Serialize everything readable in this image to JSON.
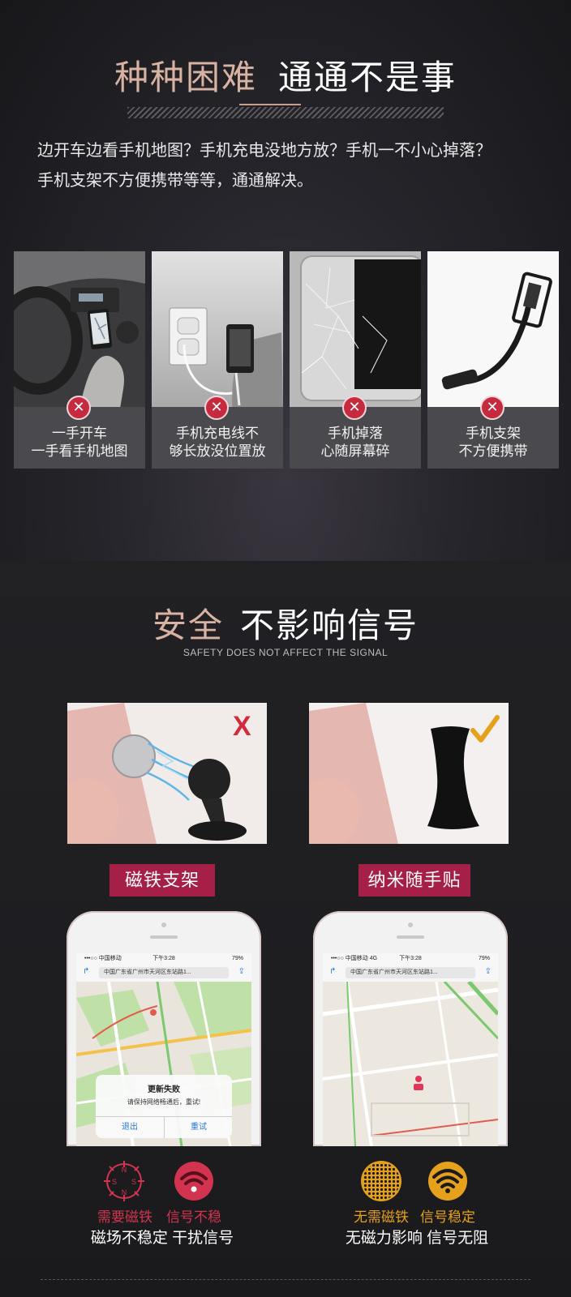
{
  "section1": {
    "title_part1": "种种困难",
    "title_part2": "通通不是事",
    "intro_line1": "边开车边看手机地图？手机充电没地方放？手机一不小心掉落？",
    "intro_line2": "手机支架不方便携带等等，通通解决。",
    "cards": [
      {
        "line1": "一手开车",
        "line2": "一手看手机地图"
      },
      {
        "line1": "手机充电线不",
        "line2": "够长放没位置放"
      },
      {
        "line1": "手机掉落",
        "line2": "心随屏幕碎"
      },
      {
        "line1": "手机支架",
        "line2": "不方便携带"
      }
    ],
    "x_glyph": "✕"
  },
  "section2": {
    "title_part1": "安全",
    "title_part2": "不影响信号",
    "subtitle": "SAFETY DOES NOT AFFECT THE SIGNAL",
    "left": {
      "badge": "磁铁支架",
      "mark": "X",
      "status_carrier": "•••○○ 中国移动",
      "status_time": "下午3:28",
      "status_battery": "79%",
      "address": "中国广东省广州市天河区东站路1...",
      "dialog_title": "更新失败",
      "dialog_message": "请保持网络畅通后，重试!",
      "dialog_cancel": "退出",
      "dialog_retry": "重试",
      "label1": "需要磁铁",
      "label2": "信号不稳",
      "bottom": "磁场不稳定 干扰信号",
      "compass_letters": [
        "N",
        "S",
        "S",
        "N"
      ]
    },
    "right": {
      "badge": "纳米随手贴",
      "mark": "✓",
      "status_carrier": "•••○○ 中国移动  4G",
      "status_time": "下午3:28",
      "status_battery": "79%",
      "address": "中国广东省广州市天河区东站路1...",
      "label1": "无需磁铁",
      "label2": "信号稳定",
      "bottom": "无磁力影响 信号无阻"
    },
    "colors": {
      "badge": "#a61f47",
      "warn_red": "#d2344f",
      "ok_gold": "#e5a11c"
    }
  }
}
